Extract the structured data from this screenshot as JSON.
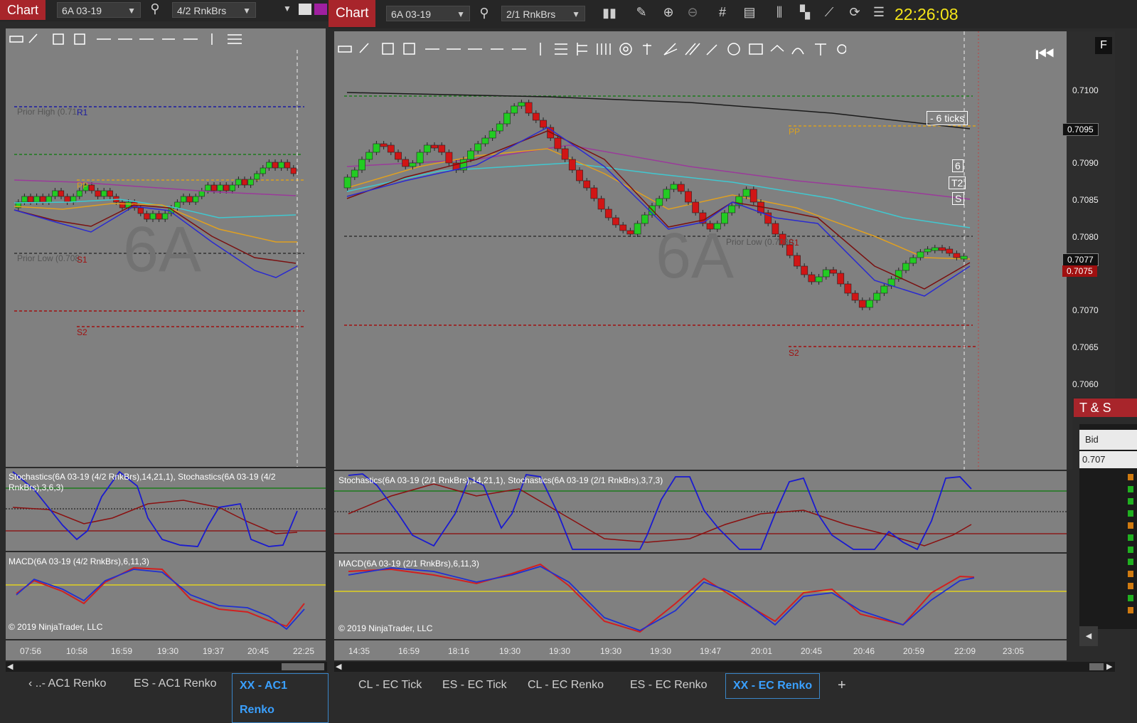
{
  "left": {
    "title": "Chart",
    "instrument": "6A 03-19",
    "bar_type": "4/2 RnkBrs",
    "watermark": "6A",
    "labels": {
      "prior_high": "Prior High (0.71",
      "r1": "R1",
      "pp": "PP",
      "prior_low": "Prior Low (0.708",
      "s1": "S1",
      "s2": "S2"
    },
    "stoch_label": "Stochastics(6A 03-19 (4/2 RnkBrs),14,21,1), Stochastics(6A 03-19 (4/2 RnkBrs),3,6,3)",
    "macd_label": "MACD(6A 03-19 (4/2 RnkBrs),6,11,3)",
    "copyright": "© 2019 NinjaTrader, LLC",
    "times": [
      "07:56",
      "10:58",
      "16:59",
      "19:30",
      "19:37",
      "20:45",
      "22:25"
    ]
  },
  "right": {
    "title": "Chart",
    "instrument": "6A 03-19",
    "bar_type": "2/1 RnkBrs",
    "clock": "22:26:08",
    "watermark": "6A",
    "labels": {
      "pp": "PP",
      "prior_low": "Prior Low (0.7080",
      "s1": "S1",
      "s2": "S2",
      "ticks": "- 6 ticks",
      "six": "6",
      "t2": "T2",
      "s": "S"
    },
    "stoch_label": "Stochastics(6A 03-19 (2/1 RnkBrs),14,21,1), Stochastics(6A 03-19 (2/1 RnkBrs),3,7,3)",
    "macd_label": "MACD(6A 03-19 (2/1 RnkBrs),6,11,3)",
    "copyright": "© 2019 NinjaTrader, LLC",
    "times": [
      "14:35",
      "16:59",
      "18:16",
      "19:30",
      "19:30",
      "19:30",
      "19:30",
      "19:47",
      "20:01",
      "20:45",
      "20:46",
      "20:59",
      "22:09",
      "23:05"
    ],
    "prices": [
      "0.7100",
      "0.7095",
      "0.7090",
      "0.7085",
      "0.7080",
      "0.7077",
      "0.7075",
      "0.7070",
      "0.7065",
      "0.7060"
    ],
    "price_tags": {
      "top": "0.7095",
      "last": "0.7077",
      "bid": "0.7075"
    },
    "f_button": "F"
  },
  "tns": {
    "title": "T & S",
    "bid_label": "Bid",
    "bid_value": "0.707"
  },
  "tabs_left": [
    "‹ ..- AC1 Renko",
    "ES - AC1 Renko",
    "XX - AC1 Renko"
  ],
  "tabs_right": [
    "CL - EC Tick",
    "ES - EC Tick",
    "CL - EC Renko",
    "ES - EC Renko",
    "XX - EC Renko",
    "+"
  ],
  "colors": {
    "up": "#22cc22",
    "down": "#d01515",
    "accent": "#3aa0ff",
    "clock": "#f5e51a",
    "badge": "#a8252b"
  }
}
